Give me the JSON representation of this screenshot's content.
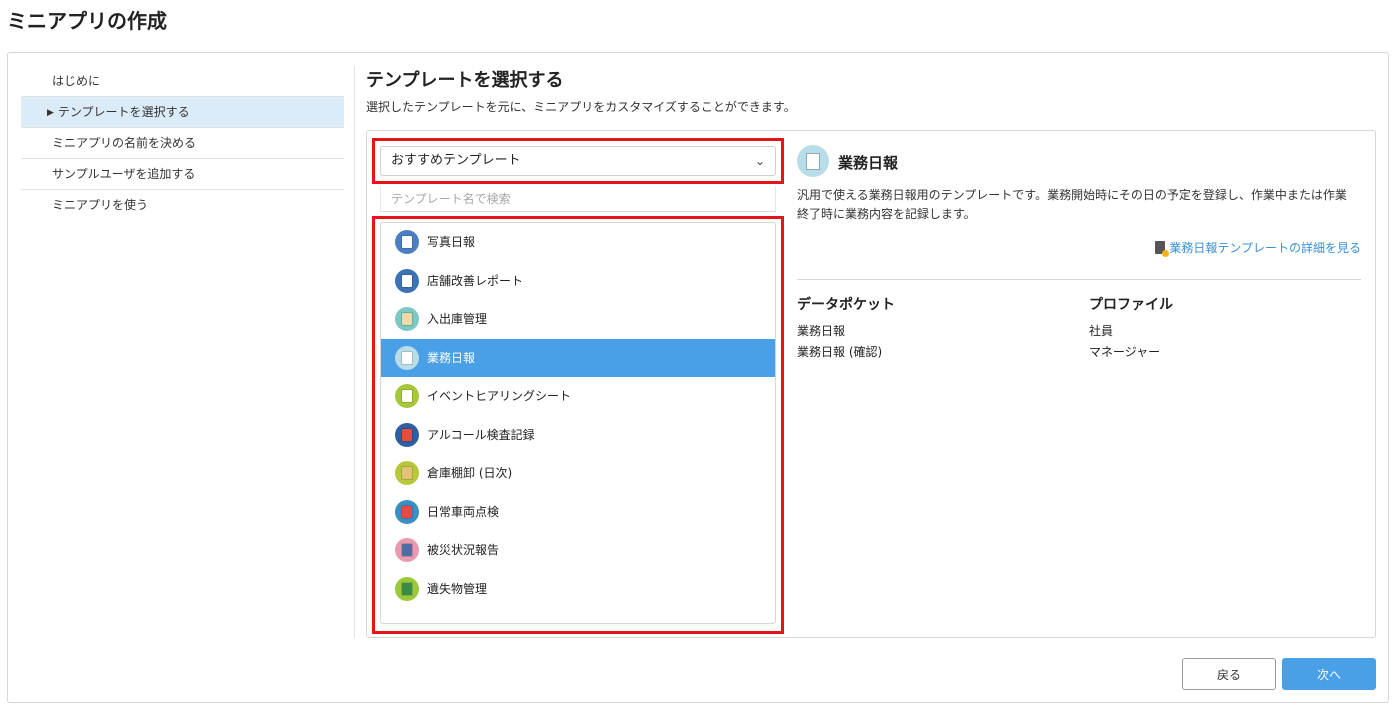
{
  "page_title": "ミニアプリの作成",
  "steps": [
    {
      "label": "はじめに"
    },
    {
      "label": "テンプレートを選択する",
      "active": true
    },
    {
      "label": "ミニアプリの名前を決める"
    },
    {
      "label": "サンプルユーザを追加する"
    },
    {
      "label": "ミニアプリを使う"
    }
  ],
  "section": {
    "title": "テンプレートを選択する",
    "description": "選択したテンプレートを元に、ミニアプリをカスタマイズすることができます。"
  },
  "dropdown": {
    "selected": "おすすめテンプレート"
  },
  "search": {
    "placeholder": "テンプレート名で検索"
  },
  "templates": [
    {
      "label": "写真日報",
      "icon": "photo-report-icon",
      "color": "#4a7fc0"
    },
    {
      "label": "店舗改善レポート",
      "icon": "store-report-icon",
      "color": "#3d72b5"
    },
    {
      "label": "入出庫管理",
      "icon": "warehouse-icon",
      "color": "#7cc8c2"
    },
    {
      "label": "業務日報",
      "icon": "business-report-icon",
      "color": "#b9dde8",
      "selected": true
    },
    {
      "label": "イベントヒアリングシート",
      "icon": "event-sheet-icon",
      "color": "#a7c83a"
    },
    {
      "label": "アルコール検査記録",
      "icon": "alcohol-check-icon",
      "color": "#2f5f9e"
    },
    {
      "label": "倉庫棚卸 (日次)",
      "icon": "inventory-icon",
      "color": "#b9c83a"
    },
    {
      "label": "日常車両点検",
      "icon": "vehicle-check-icon",
      "color": "#3d8fc0"
    },
    {
      "label": "被災状況報告",
      "icon": "disaster-report-icon",
      "color": "#e79ab0"
    },
    {
      "label": "遺失物管理",
      "icon": "lost-item-icon",
      "color": "#9ac83a"
    }
  ],
  "detail": {
    "title": "業務日報",
    "description": "汎用で使える業務日報用のテンプレートです。業務開始時にその日の予定を登録し、作業中または作業終了時に業務内容を記録します。",
    "link": "業務日報テンプレートの詳細を見る",
    "data_pocket_head": "データポケット",
    "data_pockets": [
      "業務日報",
      "業務日報 (確認)"
    ],
    "profile_head": "プロファイル",
    "profiles": [
      "社員",
      "マネージャー"
    ]
  },
  "buttons": {
    "back": "戻る",
    "next": "次へ"
  }
}
